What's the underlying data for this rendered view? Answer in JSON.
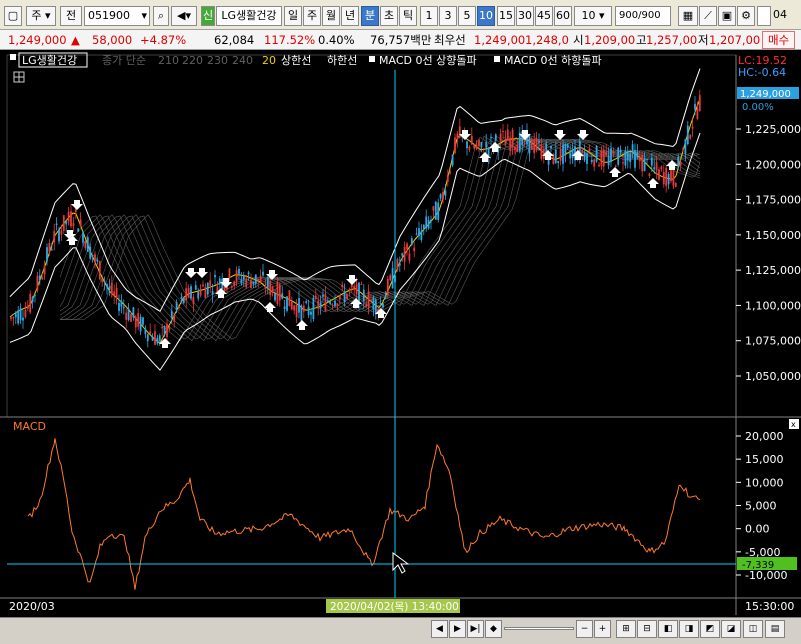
{
  "toolbar": {
    "period_select": "주",
    "range_select": "전",
    "code_value": "051900",
    "stock_badge": "신",
    "stock_name": "LG생활건강",
    "tabs": [
      "일",
      "주",
      "월",
      "년",
      "분",
      "초",
      "틱"
    ],
    "active_tab": "분",
    "intervals": [
      "1",
      "3",
      "5",
      "10",
      "15",
      "30",
      "45",
      "60"
    ],
    "active_interval": "10",
    "interval_select": "10",
    "count_value": "900",
    "count_total": "/900",
    "right_cut": "04"
  },
  "quote": {
    "price": "1,249,000",
    "change_arrow": "▲",
    "change": "58,000",
    "change_pct": "+4.87%",
    "volume": "62,084",
    "volume_ratio": "117.52%",
    "turnover": "0.40%",
    "amount": "76,757백만",
    "best_label": "최우선",
    "best_ask": "1,249,00",
    "best_bid": "1,248,0",
    "open_label": "시",
    "open": "1,209,00",
    "high_label": "고",
    "high": "1,257,00",
    "low_label": "저",
    "low": "1,207,00",
    "buy_button": "매수"
  },
  "legend": {
    "name": "LG생활건강",
    "ma_label": "종가 단순",
    "ma_periods": [
      "210",
      "220",
      "230",
      "240"
    ],
    "ma_active": "20",
    "band_upper": "상한선",
    "band_lower": "하한선",
    "signal_up": "MACD 0선 상향돌파",
    "signal_down": "MACD 0선 하향돌파"
  },
  "price_axis": {
    "lc_label": "LC:19.52",
    "hc_label": "HC:-0.64",
    "current_price": "1,249,000",
    "current_pct": "0.00%",
    "ticks": [
      "1,225,000",
      "1,200,000",
      "1,175,000",
      "1,150,000",
      "1,125,000",
      "1,100,000",
      "1,075,000",
      "1,050,000"
    ]
  },
  "macd": {
    "title": "MACD",
    "ticks": [
      "20,000",
      "15,000",
      "10,000",
      "5,000",
      "0.00",
      "-5,000",
      "-10,000"
    ],
    "current_value": "-7,339"
  },
  "time_axis": {
    "start_label": "2020/03",
    "cursor_label": "2020/04/02(목) 13:40:00",
    "end_time": "15:30:00"
  },
  "colors": {
    "background": "#000000",
    "up_candle": "#e83a3a",
    "down_candle": "#2fa8e8",
    "band": "#ffffff",
    "ma_line": "#f0d000",
    "macd_line": "#ff7a2a",
    "crosshair": "#00e0ff",
    "current_tag": "#00b050"
  }
}
